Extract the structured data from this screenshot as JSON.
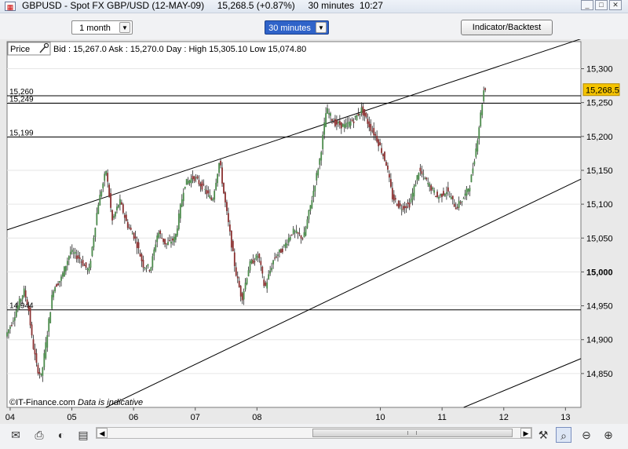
{
  "window": {
    "title": "GBPUSD - Spot FX GBP/USD (12-MAY-09)     15,268.5 (+0.87%)     30 minutes  10:27",
    "app_icon": "chart-app-icon"
  },
  "toolbar": {
    "period_select": "1 month",
    "interval_select": "30 minutes",
    "indicator_button": "Indicator/Backtest"
  },
  "chart_header": {
    "price_label": "Price",
    "quote": "Bid : 15,267.0  Ask : 15,270.0   Day : High 15,305.10 Low 15,074.80"
  },
  "chart_footer": {
    "copyright": "©IT-Finance.com",
    "disclaimer": "Data is indicative"
  },
  "colors": {
    "up_candle": "#4a8a4a",
    "down_candle": "#8a3030",
    "last_price_bg": "#f5c400",
    "line": "#000000"
  },
  "chart_data": {
    "type": "candlestick",
    "symbol": "GBPUSD",
    "interval": "30 minutes",
    "x_ticks": [
      "04",
      "05",
      "06",
      "07",
      "08",
      "10",
      "11",
      "12",
      "13"
    ],
    "x_tick_days": [
      4,
      5,
      6,
      7,
      8,
      10,
      11,
      12,
      13
    ],
    "xlim": [
      3.95,
      13.25
    ],
    "ylim": [
      14800,
      15340
    ],
    "y_ticks": [
      {
        "value": 15300,
        "label": "15,300"
      },
      {
        "value": 15250,
        "label": "15,250"
      },
      {
        "value": 15200,
        "label": "15,200"
      },
      {
        "value": 15150,
        "label": "15,150"
      },
      {
        "value": 15100,
        "label": "15,100"
      },
      {
        "value": 15050,
        "label": "15,050"
      },
      {
        "value": 15000,
        "label": "15,000"
      },
      {
        "value": 14950,
        "label": "14,950"
      },
      {
        "value": 14900,
        "label": "14,900"
      },
      {
        "value": 14850,
        "label": "14,850"
      }
    ],
    "last_price": {
      "value": 15268.5,
      "label": "15,268.5"
    },
    "horizontal_lines": [
      {
        "value": 15260,
        "label": "15,260"
      },
      {
        "value": 15249,
        "label": "15,249"
      },
      {
        "value": 15199,
        "label": "15,199"
      },
      {
        "value": 14944,
        "label": "14,944"
      }
    ],
    "trend_lines": [
      {
        "x1": 3.95,
        "y1": 15062,
        "x2": 13.25,
        "y2": 15344
      },
      {
        "x1": 5.55,
        "y1": 14800,
        "x2": 13.25,
        "y2": 15137
      },
      {
        "x1": 11.35,
        "y1": 14800,
        "x2": 13.25,
        "y2": 14872
      }
    ],
    "price_path": [
      {
        "x": 3.95,
        "y": 14905
      },
      {
        "x": 4.05,
        "y": 14925
      },
      {
        "x": 4.15,
        "y": 14950
      },
      {
        "x": 4.25,
        "y": 14972
      },
      {
        "x": 4.32,
        "y": 14948
      },
      {
        "x": 4.38,
        "y": 14900
      },
      {
        "x": 4.46,
        "y": 14858
      },
      {
        "x": 4.53,
        "y": 14845
      },
      {
        "x": 4.62,
        "y": 14905
      },
      {
        "x": 4.72,
        "y": 14975
      },
      {
        "x": 4.85,
        "y": 14990
      },
      {
        "x": 5.0,
        "y": 15030
      },
      {
        "x": 5.15,
        "y": 15020
      },
      {
        "x": 5.3,
        "y": 15000
      },
      {
        "x": 5.45,
        "y": 15100
      },
      {
        "x": 5.58,
        "y": 15150
      },
      {
        "x": 5.68,
        "y": 15075
      },
      {
        "x": 5.8,
        "y": 15105
      },
      {
        "x": 5.92,
        "y": 15070
      },
      {
        "x": 6.05,
        "y": 15050
      },
      {
        "x": 6.18,
        "y": 15010
      },
      {
        "x": 6.3,
        "y": 15005
      },
      {
        "x": 6.42,
        "y": 15060
      },
      {
        "x": 6.55,
        "y": 15040
      },
      {
        "x": 6.7,
        "y": 15050
      },
      {
        "x": 6.85,
        "y": 15130
      },
      {
        "x": 7.0,
        "y": 15140
      },
      {
        "x": 7.15,
        "y": 15125
      },
      {
        "x": 7.3,
        "y": 15105
      },
      {
        "x": 7.42,
        "y": 15165
      },
      {
        "x": 7.48,
        "y": 15120
      },
      {
        "x": 7.58,
        "y": 15060
      },
      {
        "x": 7.68,
        "y": 15000
      },
      {
        "x": 7.78,
        "y": 14960
      },
      {
        "x": 7.9,
        "y": 15010
      },
      {
        "x": 8.05,
        "y": 15025
      },
      {
        "x": 8.15,
        "y": 14975
      },
      {
        "x": 8.3,
        "y": 15020
      },
      {
        "x": 8.45,
        "y": 15035
      },
      {
        "x": 8.6,
        "y": 15060
      },
      {
        "x": 8.78,
        "y": 15050
      },
      {
        "x": 8.92,
        "y": 15110
      },
      {
        "x": 9.05,
        "y": 15170
      },
      {
        "x": 9.15,
        "y": 15240
      },
      {
        "x": 9.28,
        "y": 15220
      },
      {
        "x": 9.45,
        "y": 15215
      },
      {
        "x": 9.6,
        "y": 15225
      },
      {
        "x": 9.72,
        "y": 15240
      },
      {
        "x": 9.85,
        "y": 15215
      },
      {
        "x": 9.95,
        "y": 15200
      },
      {
        "x": 10.02,
        "y": 15185
      },
      {
        "x": 10.12,
        "y": 15160
      },
      {
        "x": 10.22,
        "y": 15110
      },
      {
        "x": 10.35,
        "y": 15095
      },
      {
        "x": 10.5,
        "y": 15100
      },
      {
        "x": 10.65,
        "y": 15150
      },
      {
        "x": 10.8,
        "y": 15130
      },
      {
        "x": 10.95,
        "y": 15110
      },
      {
        "x": 11.1,
        "y": 15120
      },
      {
        "x": 11.25,
        "y": 15095
      },
      {
        "x": 11.38,
        "y": 15110
      },
      {
        "x": 11.48,
        "y": 15130
      },
      {
        "x": 11.58,
        "y": 15185
      },
      {
        "x": 11.66,
        "y": 15240
      },
      {
        "x": 11.7,
        "y": 15268
      }
    ]
  }
}
